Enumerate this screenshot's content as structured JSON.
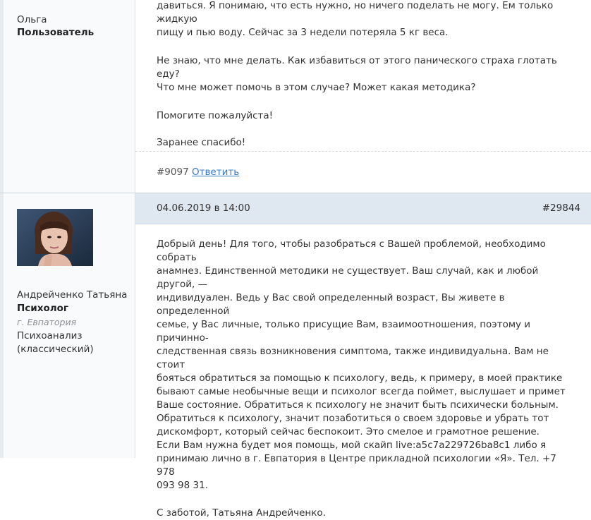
{
  "post1": {
    "author": {
      "name": "Ольга",
      "role": "Пользователь"
    },
    "lines": [
      "давиться. Я понимаю, что есть нужно, но ничего поделать не могу. Ем только жидкую",
      "пищу и пью воду. Сейчас за 3 недели потеряла 5 кг веса."
    ],
    "para2": [
      "Не знаю, что мне делать. Как избавиться от этого панического страха глотать еду?",
      "Что мне может помочь в этом случае? Может какая методика?"
    ],
    "para3": "Помогите пожалуйста!",
    "para4": "Заранее спасибо!",
    "id": "#9097",
    "reply": "Ответить"
  },
  "post2": {
    "date": "04.06.2019 в 14:00",
    "number": "#29844",
    "author": {
      "name": "Андрейченко Татьяна",
      "role": "Психолог",
      "city": "г. Евпатория",
      "specialty": [
        "Психоанализ",
        "(классический)"
      ]
    },
    "body": [
      "Добрый день! Для того, чтобы разобраться с Вашей проблемой, необходимо собрать",
      "анамнез. Единственной методики не существует. Ваш случай, как и любой другой, —",
      "индивидуален. Ведь у Вас свой определенный возраст, Вы живете в определенной",
      "семье, у Вас личные, только присущие Вам, взаимоотношения, поэтому и причинно-",
      "следственная связь возникновения симптома, также индивидуальна. Вам не стоит",
      "бояться обратиться за помощью к психологу, ведь, к примеру, в моей практике",
      "бывают самые необычные вещи и психолог всегда поймет, выслушает и примет",
      "Ваше состояние. Обратиться к психологу не значит быть психически больным.",
      "Обратиться к психологу, значит позаботиться о своем здоровье и убрать тот",
      "дискомфорт, который сейчас беспокоит. Это смелое и грамотное решение.",
      "Если Вам нужна будет моя помощь, мой скайп live:a5c7a229726ba8c1 либо я",
      "принимаю лично в г. Евпатория в Центре прикладной психологии «Я». Тел. +7 978",
      "093 98 31."
    ],
    "signature": "С заботой, Татьяна Андрейченко."
  }
}
